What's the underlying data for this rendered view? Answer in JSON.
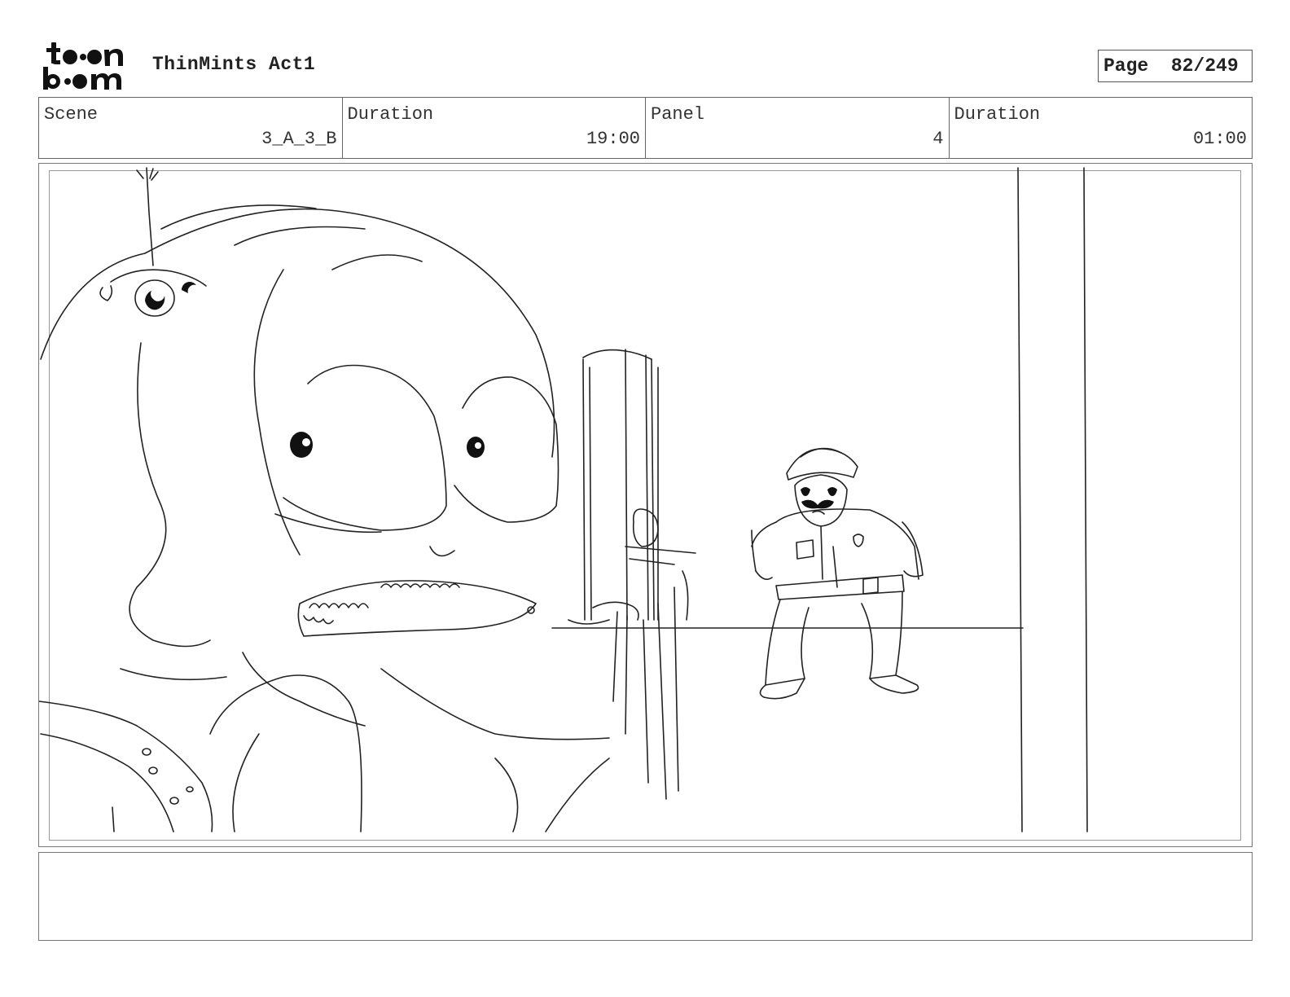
{
  "header": {
    "logo_text_top": "t••n",
    "logo_text_bottom": "b••m",
    "project_title": "ThinMints Act1",
    "page_label": "Page",
    "page_value": "82/249"
  },
  "info": {
    "scene_label": "Scene",
    "scene_value": "3_A_3_B",
    "scene_duration_label": "Duration",
    "scene_duration_value": "19:00",
    "panel_label": "Panel",
    "panel_value": "4",
    "panel_duration_label": "Duration",
    "panel_duration_value": "01:00"
  },
  "notes": {
    "text": ""
  }
}
